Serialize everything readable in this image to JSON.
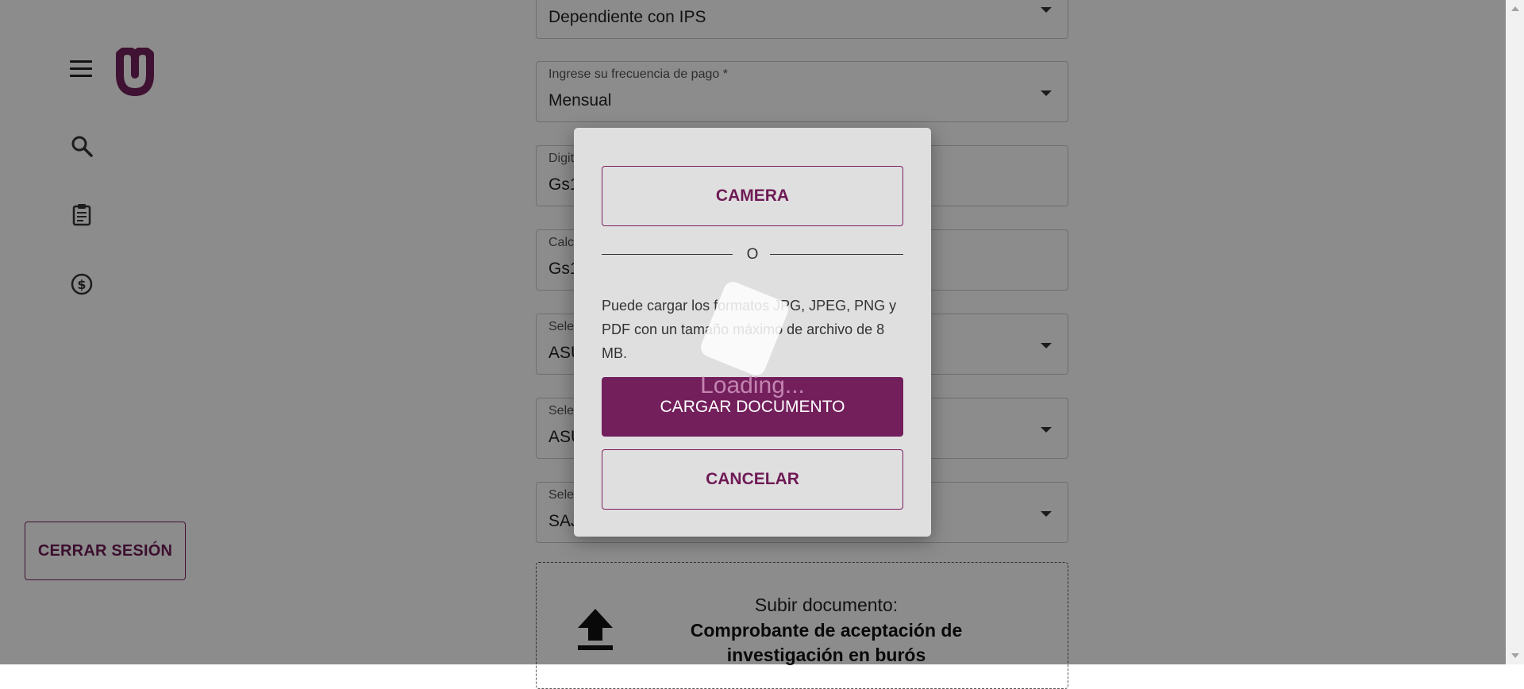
{
  "colors": {
    "brand": "#731f5c",
    "overlay": "rgba(0,0,0,0.45)"
  },
  "sidebar": {
    "menu_icon": "hamburger-icon",
    "logo_icon": "brand-logo-icon",
    "nav_icons": [
      "search-icon",
      "clipboard-icon",
      "dollar-circle-icon"
    ],
    "logout_label": "CERRAR SESIÓN"
  },
  "form": {
    "fields": [
      {
        "label": "",
        "value": "Dependiente con IPS"
      },
      {
        "label": "Ingrese su frecuencia de pago *",
        "value": "Mensual"
      },
      {
        "label": "Digit",
        "value": "Gs1"
      },
      {
        "label": "Calc",
        "value": "Gs1"
      },
      {
        "label": "Sele",
        "value": "ASU"
      },
      {
        "label": "Sele",
        "value": "ASU"
      },
      {
        "label": "Sele",
        "value": "SAJ"
      }
    ],
    "upload": {
      "title": "Subir documento:",
      "document": "Comprobante de aceptación de investigación en burós"
    }
  },
  "dialog": {
    "camera_label": "CAMERA",
    "divider_text": "O",
    "info_text": "Puede cargar los formatos JPG, JPEG, PNG y PDF con un tamaño máximo de archivo de 8 MB.",
    "upload_label": "CARGAR DOCUMENTO",
    "cancel_label": "CANCELAR",
    "loading_text": "Loading..."
  }
}
